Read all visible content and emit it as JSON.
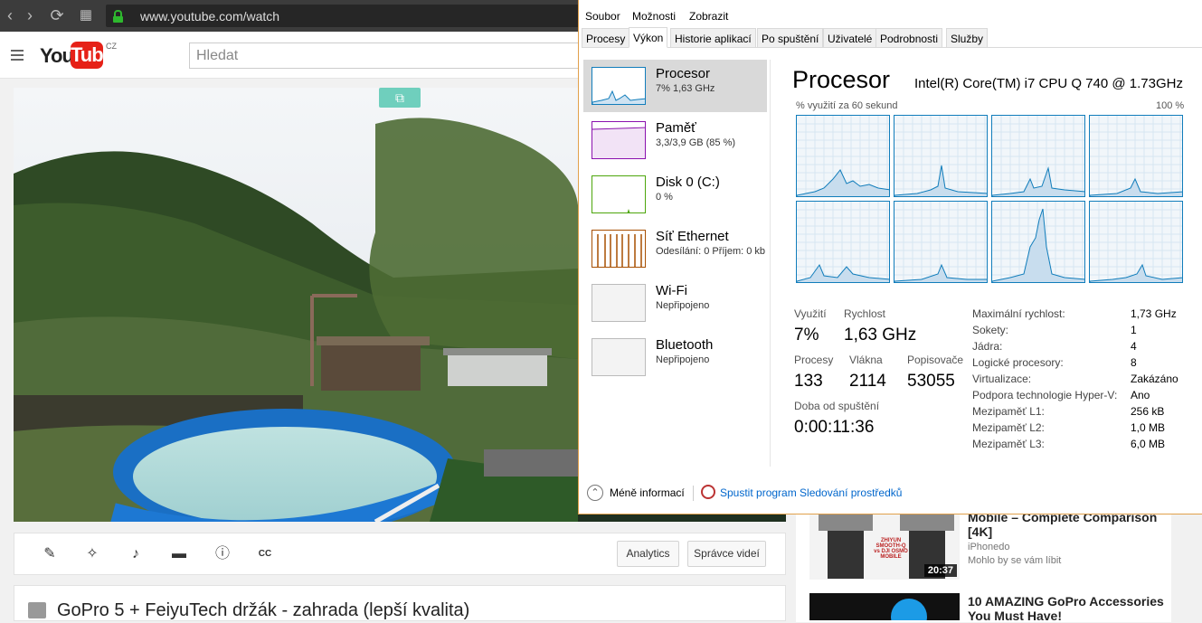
{
  "browser": {
    "url": "www.youtube.com/watch"
  },
  "youtube": {
    "logo_you": "You",
    "logo_tube": "Tube",
    "country": "CZ",
    "search_placeholder": "Hledat",
    "toolbar": {
      "analytics": "Analytics",
      "video_manager": "Správce videí"
    },
    "video_title": "GoPro 5 + FeiyuTech držák - zahrada (lepší kvalita)",
    "sidebar": [
      {
        "title": "Mobile – Complete Comparison [4K]",
        "channel": "iPhonedo",
        "meta": "Mohlo by se vám líbit",
        "duration": "20:37",
        "thumb_text": "ZHIYUN SMOOTH-Q vs DJI OSMO MOBILE"
      },
      {
        "title": "10 AMAZING GoPro Accessories You Must Have!"
      }
    ]
  },
  "task_manager": {
    "menu": [
      "Soubor",
      "Možnosti",
      "Zobrazit"
    ],
    "tabs": [
      "Procesy",
      "Výkon",
      "Historie aplikací",
      "Po spuštění",
      "Uživatelé",
      "Podrobnosti",
      "Služby"
    ],
    "active_tab": "Výkon",
    "resources": [
      {
        "name": "Procesor",
        "sub": "7% 1,63 GHz"
      },
      {
        "name": "Paměť",
        "sub": "3,3/3,9 GB (85 %)"
      },
      {
        "name": "Disk 0 (C:)",
        "sub": "0 %"
      },
      {
        "name": "Síť Ethernet",
        "sub": "Odesílání: 0 Příjem: 0 kb"
      },
      {
        "name": "Wi-Fi",
        "sub": "Nepřipojeno"
      },
      {
        "name": "Bluetooth",
        "sub": "Nepřipojeno"
      }
    ],
    "cpu": {
      "title": "Procesor",
      "model": "Intel(R) Core(TM) i7 CPU Q 740 @ 1.73GHz",
      "util_label": "% využití za 60 sekund",
      "util_max": "100 %",
      "stats": {
        "usage_label": "Využití",
        "usage": "7%",
        "speed_label": "Rychlost",
        "speed": "1,63 GHz",
        "processes_label": "Procesy",
        "processes": "133",
        "threads_label": "Vlákna",
        "threads": "2114",
        "handles_label": "Popisovače",
        "handles": "53055",
        "uptime_label": "Doba od spuštění",
        "uptime": "0:00:11:36"
      },
      "details": [
        {
          "k": "Maximální rychlost:",
          "v": "1,73 GHz"
        },
        {
          "k": "Sokety:",
          "v": "1"
        },
        {
          "k": "Jádra:",
          "v": "4"
        },
        {
          "k": "Logické procesory:",
          "v": "8"
        },
        {
          "k": "Virtualizace:",
          "v": "Zakázáno"
        },
        {
          "k": "Podpora technologie Hyper-V:",
          "v": "Ano"
        },
        {
          "k": "Mezipaměť L1:",
          "v": "256 kB"
        },
        {
          "k": "Mezipaměť L2:",
          "v": "1,0 MB"
        },
        {
          "k": "Mezipaměť L3:",
          "v": "6,0 MB"
        }
      ]
    },
    "footer": {
      "less": "Méně informací",
      "monitor": "Spustit program Sledování prostředků"
    }
  }
}
